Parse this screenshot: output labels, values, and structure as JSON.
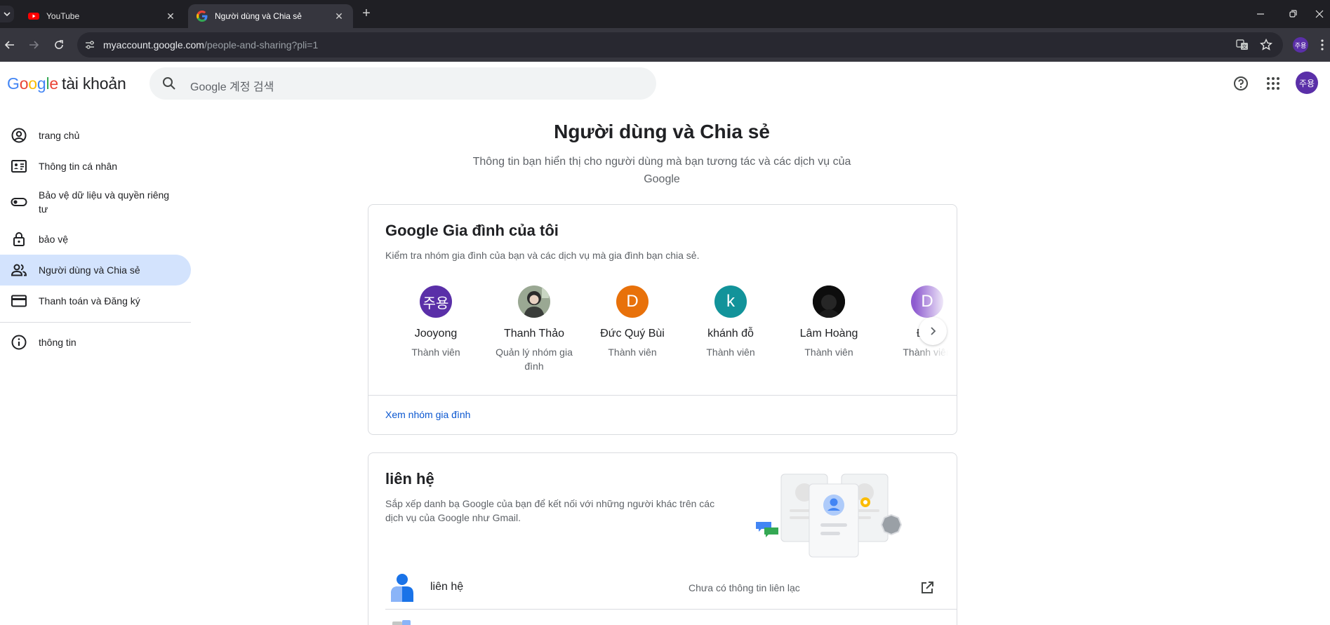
{
  "browser": {
    "tabs": [
      {
        "title": "YouTube",
        "active": false
      },
      {
        "title": "Người dùng và Chia sẻ",
        "active": true
      }
    ],
    "url_host": "myaccount.google.com",
    "url_path": "/people-and-sharing?pli=1",
    "profile_initials": "주용"
  },
  "header": {
    "logo_google": "Google",
    "logo_product": "tài khoản",
    "search_placeholder": "Google 계정 검색",
    "avatar_initials": "주용"
  },
  "sidebar": {
    "items": [
      {
        "label": "trang chủ",
        "icon": "account-circle-icon"
      },
      {
        "label": "Thông tin cá nhân",
        "icon": "id-card-icon"
      },
      {
        "label": "Bảo vệ dữ liệu và quyền riêng tư",
        "icon": "toggle-icon"
      },
      {
        "label": "bảo vệ",
        "icon": "lock-icon"
      },
      {
        "label": "Người dùng và Chia sẻ",
        "icon": "people-icon",
        "active": true
      },
      {
        "label": "Thanh toán và Đăng ký",
        "icon": "credit-card-icon"
      },
      {
        "label": "thông tin",
        "icon": "info-icon"
      }
    ]
  },
  "main": {
    "title": "Người dùng và Chia sẻ",
    "subtitle": "Thông tin bạn hiển thị cho người dùng mà bạn tương tác và các dịch vụ của Google",
    "family": {
      "title": "Google Gia đình của tôi",
      "description": "Kiểm tra nhóm gia đình của bạn và các dịch vụ mà gia đình bạn chia sẻ.",
      "members": [
        {
          "name": "Jooyong",
          "role": "Thành viên",
          "avatar_text": "주용",
          "avatar_color": "#5a2fa8"
        },
        {
          "name": "Thanh Thảo",
          "role": "Quản lý nhóm gia đình",
          "avatar_text": "",
          "avatar_color": "#8a9a80"
        },
        {
          "name": "Đức Quý Bùi",
          "role": "Thành viên",
          "avatar_text": "D",
          "avatar_color": "#e8710a"
        },
        {
          "name": "khánh đỗ",
          "role": "Thành viên",
          "avatar_text": "k",
          "avatar_color": "#12939a"
        },
        {
          "name": "Lâm Hoàng",
          "role": "Thành viên",
          "avatar_text": "",
          "avatar_color": "#111111"
        },
        {
          "name": "Đức",
          "role": "Thành viên",
          "avatar_text": "D",
          "avatar_color": "#8e5bd0"
        }
      ],
      "link": "Xem nhóm gia đình"
    },
    "contacts": {
      "title": "liên hệ",
      "description": "Sắp xếp danh bạ Google của bạn để kết nối với những người khác trên các dịch vụ của Google như Gmail.",
      "row_label": "liên hệ",
      "row_status": "Chưa có thông tin liên lạc"
    }
  },
  "colors": {
    "active_nav_bg": "#d3e3fd",
    "link": "#0b57d0",
    "avatar_purple": "#5a2fa8"
  }
}
